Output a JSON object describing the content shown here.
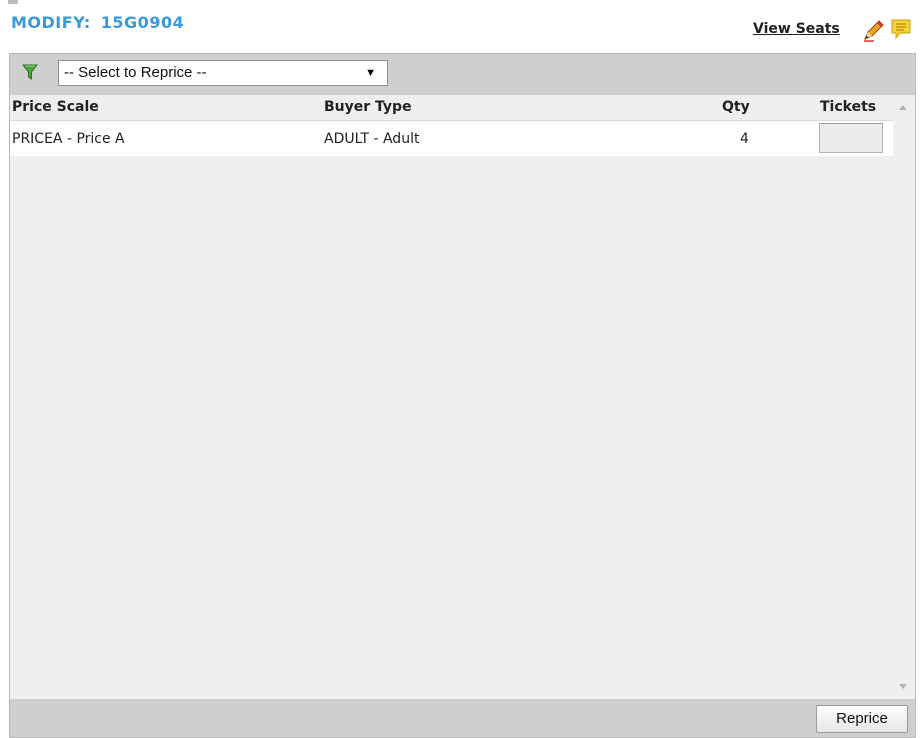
{
  "header": {
    "title_prefix": "MODIFY:",
    "order_code": "15G0904",
    "view_seats_label": "View Seats"
  },
  "toolbar": {
    "filter_icon": "filter-icon",
    "reprice_select_value": "-- Select to Reprice --"
  },
  "table": {
    "columns": [
      "Price Scale",
      "Buyer Type",
      "Qty",
      "Tickets"
    ],
    "rows": [
      {
        "price_scale": "PRICEA - Price A",
        "buyer_type": "ADULT - Adult",
        "qty": "4",
        "tickets": ""
      }
    ]
  },
  "footer": {
    "reprice_label": "Reprice"
  },
  "colors": {
    "title": "#3a9ad9",
    "toolbar_bg": "#cfcfcf",
    "panel_bg": "#efefef"
  }
}
